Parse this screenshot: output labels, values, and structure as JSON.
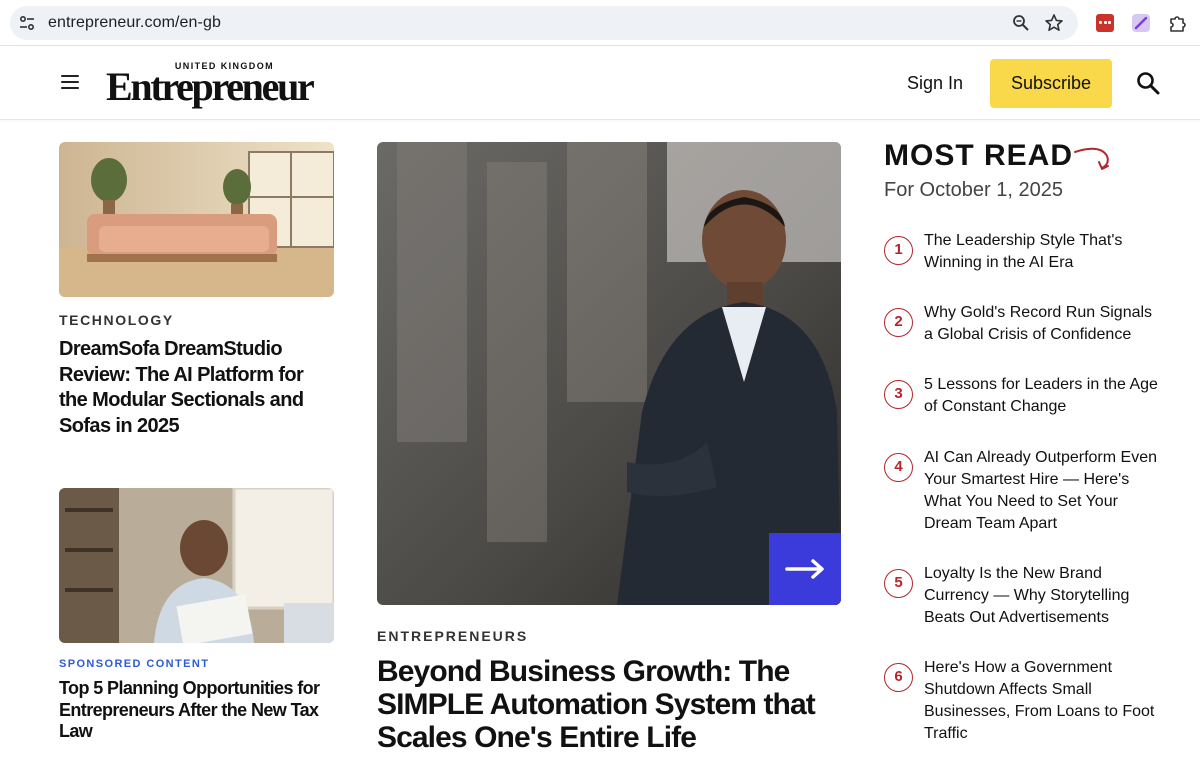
{
  "browser": {
    "url": "entrepreneur.com/en-gb",
    "site_info_icon": "tune-icon",
    "zoom_icon": "zoom-icon",
    "bookmark_icon": "star-icon",
    "extensions": [
      "red-extension-icon",
      "pen-extension-icon",
      "puzzle-extension-icon"
    ]
  },
  "header": {
    "menu_icon": "hamburger-menu-icon",
    "logo_region": "UNITED KINGDOM",
    "logo_word": "Entrepreneur",
    "sign_in": "Sign In",
    "subscribe": "Subscribe",
    "search_icon": "search-icon",
    "subscribe_color": "#f9d84a"
  },
  "left_column": {
    "card1": {
      "image": "pink-sofa-living-room",
      "kicker": "TECHNOLOGY",
      "title": "DreamSofa DreamStudio Review: The AI Platform for the Modular Sectionals and Sofas in 2025"
    },
    "card2": {
      "image": "man-reading-papers-at-laptop",
      "kicker": "SPONSORED CONTENT",
      "title": "Top 5 Planning Opportunities for Entrepreneurs After the New Tax Law"
    }
  },
  "feature": {
    "image": "smiling-man-in-suit-city-backdrop",
    "arrow_icon": "right-arrow-icon",
    "kicker": "ENTREPRENEURS",
    "title": "Beyond Business Growth: The SIMPLE Automation System that Scales One's Entire Life",
    "arrow_color": "#3b3bdb"
  },
  "most_read": {
    "title": "MOST READ",
    "date": "For October 1, 2025",
    "accent_color": "#b3262d",
    "items": [
      {
        "num": "1",
        "title": "The Leadership Style That's Winning in the AI Era"
      },
      {
        "num": "2",
        "title": "Why Gold's Record Run Signals a Global Crisis of Confidence"
      },
      {
        "num": "3",
        "title": "5 Lessons for Leaders in the Age of Constant Change"
      },
      {
        "num": "4",
        "title": "AI Can Already Outperform Even Your Smartest Hire — Here's What You Need to Set Your Dream Team Apart"
      },
      {
        "num": "5",
        "title": "Loyalty Is the New Brand Currency — Why Storytelling Beats Out Advertisements"
      },
      {
        "num": "6",
        "title": "Here's How a Government Shutdown Affects Small Businesses, From Loans to Foot Traffic"
      }
    ]
  }
}
